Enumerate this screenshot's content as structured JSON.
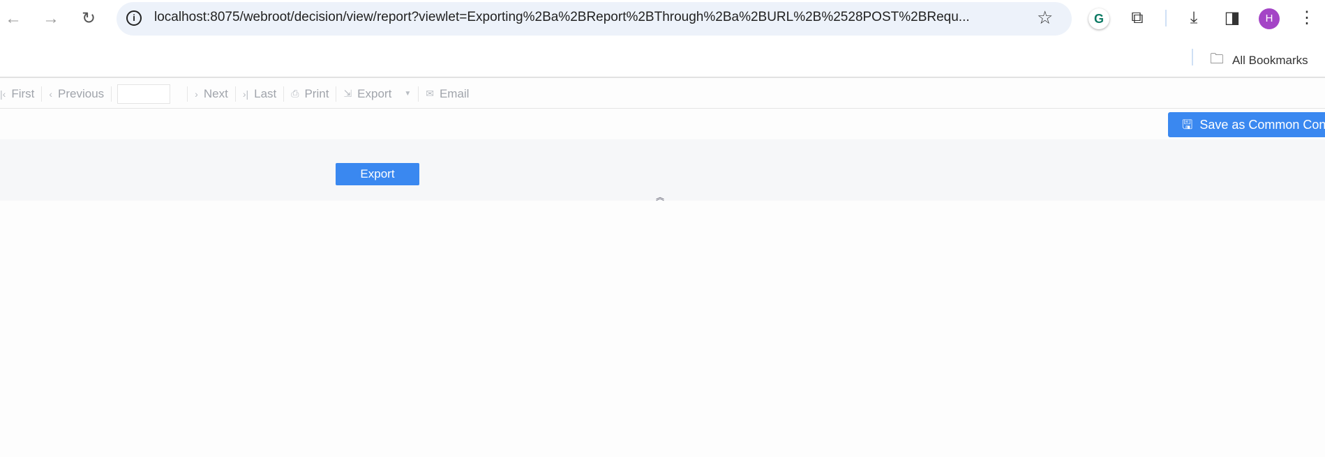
{
  "browser": {
    "url": "localhost:8075/webroot/decision/view/report?viewlet=Exporting%2Ba%2BReport%2BThrough%2Ba%2BURL%2B%2528POST%2BRequ...",
    "avatar_letter": "H",
    "bookmarks_label": "All Bookmarks"
  },
  "toolbar": {
    "first": "First",
    "previous": "Previous",
    "page_value": "",
    "next": "Next",
    "last": "Last",
    "print": "Print",
    "export": "Export",
    "email": "Email"
  },
  "save_button": "Save as Common Con",
  "params": {
    "export_button": "Export"
  },
  "colors": {
    "accent": "#3a88f0"
  }
}
